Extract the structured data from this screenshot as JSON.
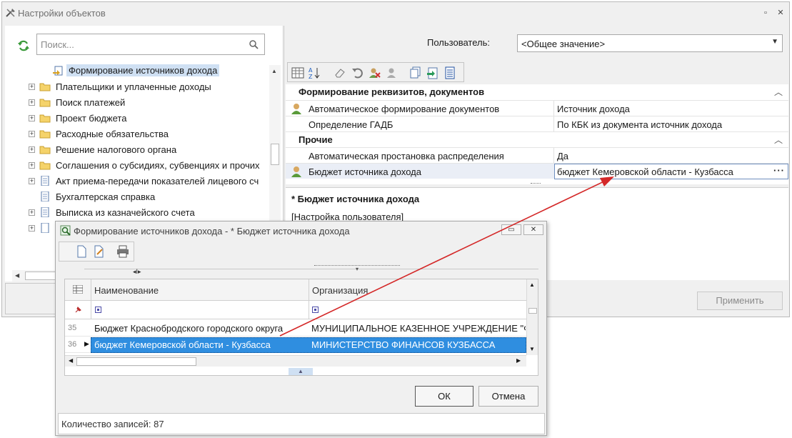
{
  "window": {
    "title": "Настройки объектов",
    "controls": [
      "▫",
      "✕"
    ]
  },
  "left": {
    "search_placeholder": "Поиск...",
    "tree": [
      {
        "label": "Формирование источников дохода",
        "icon": "doc-arrow-icon",
        "expand": "",
        "selected": true
      },
      {
        "label": "Плательщики и уплаченные доходы",
        "icon": "folder-icon",
        "expand": "+"
      },
      {
        "label": "Поиск платежей",
        "icon": "folder-icon",
        "expand": "+"
      },
      {
        "label": "Проект бюджета",
        "icon": "folder-icon",
        "expand": "+"
      },
      {
        "label": "Расходные обязательства",
        "icon": "folder-icon",
        "expand": "+"
      },
      {
        "label": "Решение налогового органа",
        "icon": "folder-icon",
        "expand": "+"
      },
      {
        "label": "Соглашения о субсидиях, субвенциях и прочих",
        "icon": "folder-icon",
        "expand": "+"
      },
      {
        "label": "Акт приема-передачи показателей лицевого сч",
        "icon": "doc-icon",
        "expand": "+"
      },
      {
        "label": "Бухгалтерская справка",
        "icon": "doc-icon",
        "expand": ""
      },
      {
        "label": "Выписка из казначейского счета",
        "icon": "doc-icon",
        "expand": "+"
      }
    ]
  },
  "right": {
    "user_label": "Пользователь:",
    "user_value": "<Общее значение>",
    "categories": [
      {
        "title": "Формирование реквизитов, документов"
      },
      {
        "title": "Прочие"
      }
    ],
    "properties": [
      {
        "name": "Автоматическое формирование документов",
        "value": "Источник дохода",
        "user_icon": true
      },
      {
        "name": "Определение ГАДБ",
        "value": "По КБК из документа источник дохода",
        "user_icon": false
      },
      {
        "name": "Автоматическая простановка распределения",
        "value": "Да",
        "user_icon": false
      },
      {
        "name": "Бюджет источника дохода",
        "value": "бюджет Кемеровской области - Кузбасса",
        "user_icon": true
      }
    ],
    "ellipsis": "···",
    "description_title": "* Бюджет источника дохода",
    "description_text": "[Настройка пользователя]",
    "apply_label": "Применить"
  },
  "dialog": {
    "title": "Формирование источников дохода - * Бюджет источника дохода",
    "columns": [
      "Наименование",
      "Организация"
    ],
    "rows": [
      {
        "num": "35",
        "name": "Бюджет Краснобродского городского округа",
        "org": "МУНИЦИПАЛЬНОЕ  КАЗЕННОЕ  УЧРЕЖДЕНИЕ  \"ФИ"
      },
      {
        "num": "36",
        "name": "бюджет Кемеровской области - Кузбасса",
        "org": "МИНИСТЕРСТВО ФИНАНСОВ КУЗБАССА",
        "selected": true
      }
    ],
    "ok_label": "ОК",
    "cancel_label": "Отмена",
    "status": "Количество записей: 87"
  },
  "colors": {
    "selection": "#2f8ee0",
    "arrow": "#d42828",
    "tree_selection": "#cfe0f3"
  }
}
